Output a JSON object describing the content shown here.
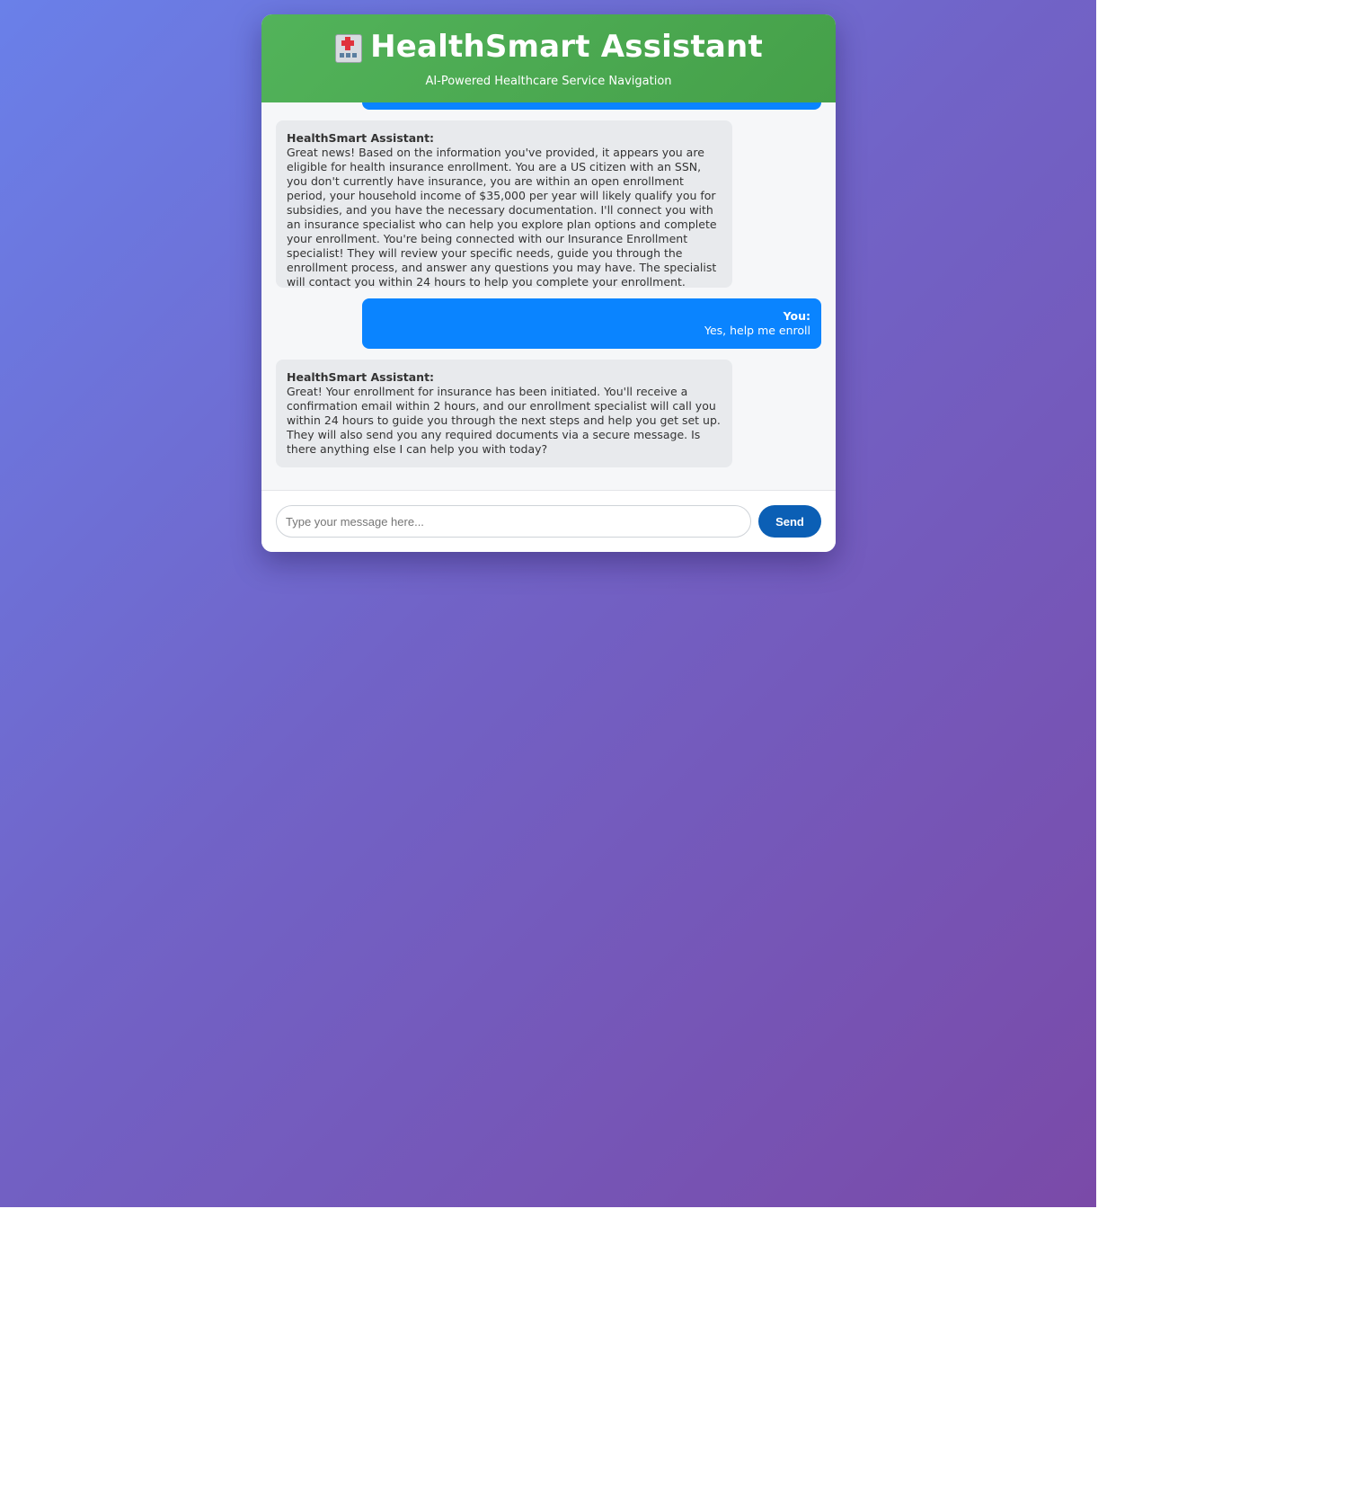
{
  "header": {
    "icon": "hospital-icon",
    "title": "HealthSmart Assistant",
    "subtitle": "AI-Powered Healthcare Service Navigation"
  },
  "messages": [
    {
      "role": "user",
      "sender": "",
      "text": ""
    },
    {
      "role": "bot",
      "sender": "HealthSmart Assistant:",
      "text": "Great news! Based on the information you've provided, it appears you are eligible for health insurance enrollment. You are a US citizen with an SSN, you don't currently have insurance, you are within an open enrollment period, your household income of $35,000 per year will likely qualify you for subsidies, and you have the necessary documentation. I'll connect you with an insurance specialist who can help you explore plan options and complete your enrollment. You're being connected with our Insurance Enrollment specialist! They will review your specific needs, guide you through the enrollment process, and answer any questions you may have. The specialist will contact you within 24 hours to help you complete your enrollment."
    },
    {
      "role": "user",
      "sender": "You:",
      "text": "Yes, help me enroll"
    },
    {
      "role": "bot",
      "sender": "HealthSmart Assistant:",
      "text": "Great! Your enrollment for insurance has been initiated. You'll receive a confirmation email within 2 hours, and our enrollment specialist will call you within 24 hours to guide you through the next steps and help you get set up. They will also send you any required documents via a secure message. Is there anything else I can help you with today?"
    }
  ],
  "input": {
    "placeholder": "Type your message here...",
    "value": ""
  },
  "send_label": "Send",
  "colors": {
    "header_green": "#4caf50",
    "user_bubble": "#0a84ff",
    "bot_bubble": "#e8eaed",
    "send_button": "#0b5fb5",
    "background_start": "#6a80e9",
    "background_end": "#7a4aa8"
  }
}
